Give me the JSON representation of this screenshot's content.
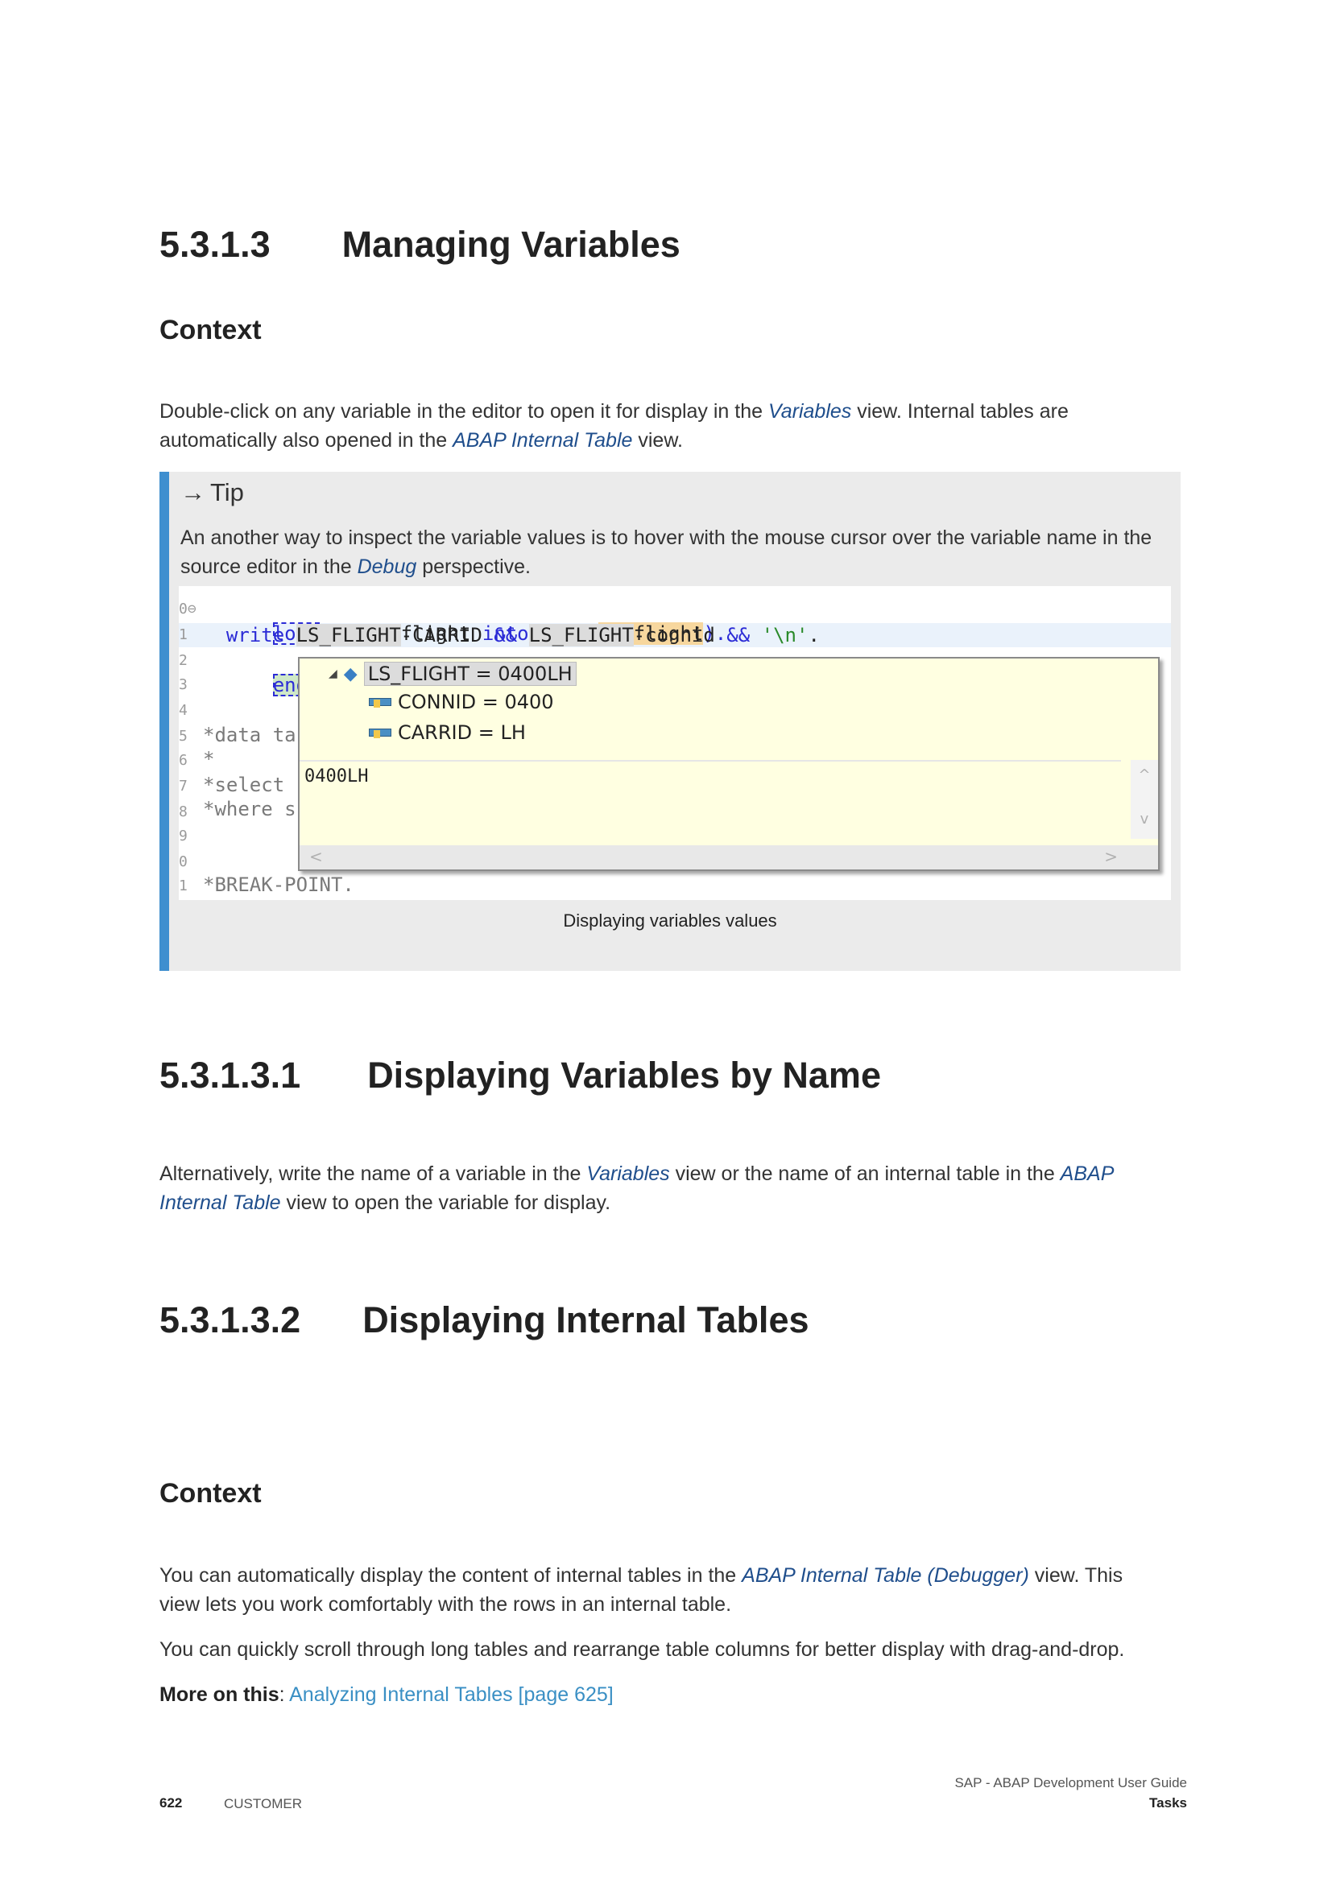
{
  "section": {
    "number": "5.3.1.3",
    "title": "Managing Variables"
  },
  "context1": {
    "heading": "Context",
    "p1_a": "Double-click on any variable in the editor to open it for display in the ",
    "p1_em1": "Variables",
    "p1_b": " view. Internal tables are",
    "p1_c": "automatically also opened in the ",
    "p1_em2": "ABAP Internal Table",
    "p1_d": " view."
  },
  "tip": {
    "arrow": "→",
    "label": "Tip",
    "text_a": "An another way to inspect the variable values is to hover with the mouse cursor over the variable name in the source editor in the ",
    "text_em": "Debug",
    "text_b": " perspective.",
    "caption": "Displaying variables values",
    "screenshot": {
      "gutter": [
        "0⊖",
        "1",
        "2",
        "3",
        "4",
        "5",
        "6",
        "7",
        "8",
        "9",
        "0",
        "1"
      ],
      "line1": {
        "kw1": "loop",
        "kw2": "at",
        "t1": "lt_flight",
        "kw3": "into data(",
        "var": "ls_flight",
        "end": ")."
      },
      "line2": {
        "kw": "write",
        "v1": "LS_FLIGHT",
        "t1": "-CARRID",
        "op": "&&",
        "v2": "LS_FLIGHT",
        "t2": "-connid",
        "str": "'\\n'",
        "end": "."
      },
      "line3": {
        "kw": "endloop",
        "end": "."
      },
      "comments": [
        "*data ta",
        "*",
        "*select",
        "*where s",
        "*BREAK-POINT."
      ],
      "popup": {
        "root": "LS_FLIGHT = 0400LH",
        "fields": [
          "CONNID = 0400",
          "CARRID = LH"
        ],
        "value": "0400LH",
        "scroll_up": "^",
        "scroll_down": "v",
        "scroll_left": "<",
        "scroll_right": ">"
      }
    }
  },
  "sub1": {
    "number": "5.3.1.3.1",
    "title": "Displaying Variables by Name",
    "p_a": "Alternatively, write the name of a variable in the ",
    "p_em1": "Variables",
    "p_b": " view or the name of an internal table in the ",
    "p_em2": "ABAP",
    "p_em3": "Internal Table",
    "p_c": " view to open the variable for display."
  },
  "sub2": {
    "number": "5.3.1.3.2",
    "title": "Displaying Internal Tables"
  },
  "context2": {
    "heading": "Context",
    "p1_a": "You can automatically display the content of internal tables in the ",
    "p1_em": "ABAP Internal Table (Debugger)",
    "p1_b": " view. This",
    "p1_c": "view lets you work comfortably with the rows in an internal table.",
    "p2": "You can quickly scroll through long tables and rearrange table columns for better display with drag-and-drop.",
    "more_label": "More on this",
    "more_sep": ": ",
    "more_link": "Analyzing Internal Tables [page 625]"
  },
  "footer": {
    "page": "622",
    "classification": "CUSTOMER",
    "doc_title": "SAP - ABAP Development User Guide",
    "chapter": "Tasks"
  }
}
